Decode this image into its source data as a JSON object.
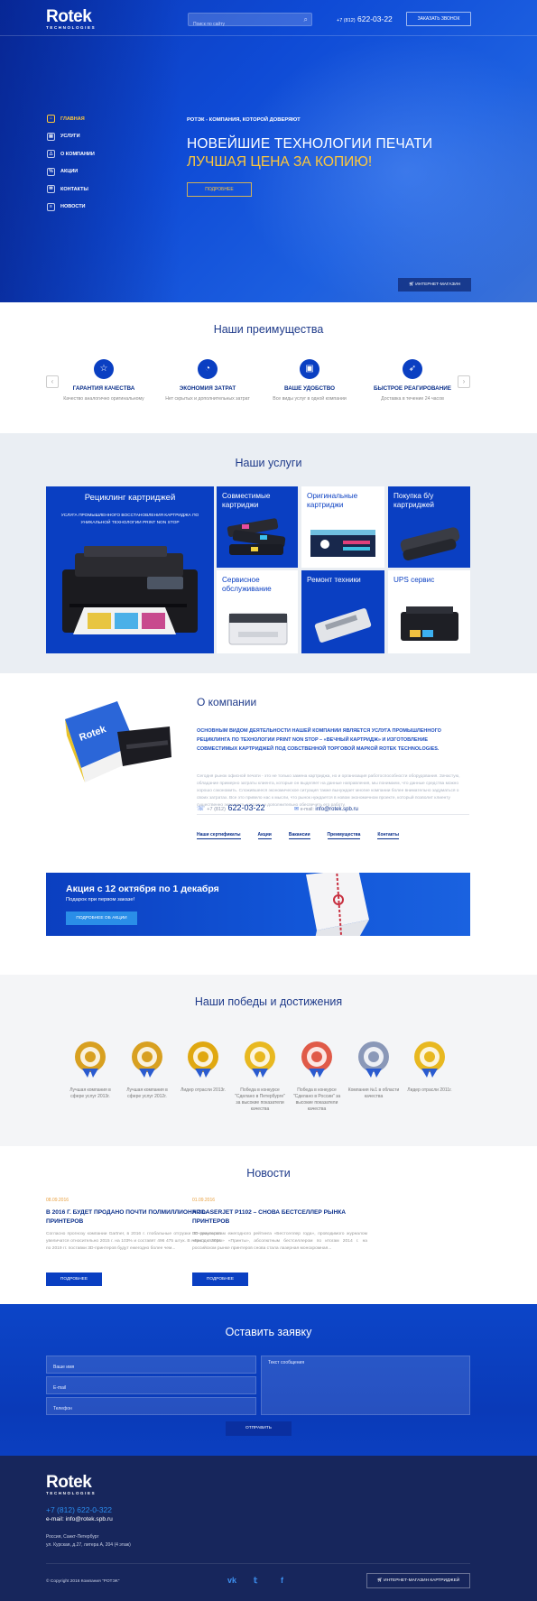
{
  "header": {
    "logo_main": "Rotek",
    "logo_sub": "TECHNOLOGIES",
    "search_placeholder": "Поиск по сайту",
    "phone_prefix": "+7 (812)",
    "phone_number": "622-03-22",
    "callback_button": "ЗАКАЗАТЬ ЗВОНОК"
  },
  "nav": {
    "items": [
      {
        "label": "ГЛАВНАЯ",
        "icon": "home-icon",
        "active": true
      },
      {
        "label": "УСЛУГИ",
        "icon": "services-icon"
      },
      {
        "label": "О КОМПАНИИ",
        "icon": "company-icon"
      },
      {
        "label": "АКЦИИ",
        "icon": "percent-icon"
      },
      {
        "label": "КОНТАКТЫ",
        "icon": "contacts-icon"
      },
      {
        "label": "НОВОСТИ",
        "icon": "news-icon"
      }
    ]
  },
  "hero": {
    "kicker": "РОТЭК - КОМПАНИЯ, КОТОРОЙ ДОВЕРЯЮТ",
    "title_line1": "НОВЕЙШИЕ ТЕХНОЛОГИИ ПЕЧАТИ",
    "title_line2": "ЛУЧШАЯ ЦЕНА ЗА КОПИЮ!",
    "more_button": "ПОДРОБНЕЕ",
    "shop_button": "ИНТЕРНЕТ-МАГАЗИН"
  },
  "advantages": {
    "title": "Наши преимущества",
    "items": [
      {
        "title": "ГАРАНТИЯ КАЧЕСТВА",
        "desc": "Качество аналогично оригинальному",
        "icon": "quality-icon"
      },
      {
        "title": "ЭКОНОМИЯ ЗАТРАТ",
        "desc": "Нет скрытых и дополнительных затрат",
        "icon": "savings-icon"
      },
      {
        "title": "ВАШЕ УДОБСТВО",
        "desc": "Все виды услуг в одной компании",
        "icon": "convenience-icon"
      },
      {
        "title": "БЫСТРОЕ РЕАГИРОВАНИЕ",
        "desc": "Доставка в течение 24 часов",
        "icon": "rocket-icon"
      }
    ]
  },
  "services": {
    "title": "Наши услуги",
    "main": {
      "title": "Рециклинг картриджей",
      "desc": "УСЛУГА ПРОМЫШЛЕННОГО ВОССТАНОВЛЕНИЯ КАРТРИДЖА ПО УНИКАЛЬНОЙ ТЕХНОЛОГИИ PRINT NON STOP"
    },
    "tiles": [
      {
        "label": "Совместимые картриджи"
      },
      {
        "label": "Оригинальные картриджи"
      },
      {
        "label": "Покупка б/у картриджей"
      },
      {
        "label": "Сервисное обслуживание"
      },
      {
        "label": "Ремонт техники"
      },
      {
        "label": "UPS сервис"
      }
    ]
  },
  "about": {
    "title": "О компании",
    "lead": "ОСНОВНЫМ ВИДОМ ДЕЯТЕЛЬНОСТИ НАШЕЙ КОМПАНИИ ЯВЛЯЕТСЯ УСЛУГА ПРОМЫШЛЕННОГО РЕЦИКЛИНГА ПО ТЕХНОЛОГИИ PRINT NON STOP – «ВЕЧНЫЙ КАРТРИДЖ» И ИЗГОТОВЛЕНИЕ СОВМЕСТИМЫХ КАРТРИДЖЕЙ ПОД СОБСТВЕННОЙ ТОРГОВОЙ МАРКОЙ ROTEK TECHNOLOGIES.",
    "text": "Сегодня рынок офисной печати - это не только замена картриджа, но и организация работоспособности оборудования. Зачастую, обладание примерно затраты клиента, которые он выделяет на данные направления, мы понимаем, что данные средства можно хорошо сэкономить. Сложившееся экономическое ситуация также вынуждает многие компании более внимательно задуматься о своих затратах. Все это привело нас к мысли, что рынок нуждается в новом экономичном проекте, который позволит клиенту существенно экономить затраты и дополнительно обеспечить его работу.",
    "phone_prefix": "+7 (812)",
    "phone": "622-03-22",
    "email_label": "e-mail:",
    "email": "info@rotek.spb.ru",
    "links": [
      "Наши сертификаты",
      "Акции",
      "Вакансии",
      "Преимущества",
      "Контакты"
    ]
  },
  "promo": {
    "title": "Акция с 12 октября по 1 декабря",
    "subtitle": "Подарок при первом заказе!",
    "button": "ПОДРОБНЕЕ ОБ АКЦИИ"
  },
  "achievements": {
    "title": "Наши победы и достижения",
    "items": [
      {
        "desc": "Лучшая компания в сфере услуг 2013г.",
        "color": "#d8a020"
      },
      {
        "desc": "Лучшая компания в сфере услуг 2012г.",
        "color": "#d8a020"
      },
      {
        "desc": "Лидер отрасли 2013г.",
        "color": "#e0a810"
      },
      {
        "desc": "Победа в конкурсе \"Сделано в Петербурге\" за высокие показатели качества",
        "color": "#e8b820"
      },
      {
        "desc": "Победа в конкурсе \"Сделано в России\" за высокие показатели качества",
        "color": "#e05a48"
      },
      {
        "desc": "Компания №1 в области качества",
        "color": "#8a98b8"
      },
      {
        "desc": "Лидер отрасли 2011г.",
        "color": "#e8b820"
      }
    ]
  },
  "news": {
    "title": "Новости",
    "items": [
      {
        "date": "08.09.2016",
        "title": "В 2016 Г. БУДЕТ ПРОДАНО ПОЧТИ ПОЛМИЛЛИОНА 3D-ПРИНТЕРОВ",
        "text": "Согласно прогнозу компании Gartner, в 2016 г. глобальные отгрузки 3D-принтеров увеличатся относительно 2015 г. на 103% и составят 496 475 штук. В период с 2016 по 2019 гг. поставки 3D-принтеров будут ежегодно более чем...",
        "button": "ПОДРОБНЕЕ"
      },
      {
        "date": "01.09.2016",
        "title": "HP LASERJET P1102 – СНОВА БЕСТСЕЛЛЕР РЫНКА ПРИНТЕРОВ",
        "text": "По результатам ежегодного рейтинга «Бестселлер года», проводимого журналом «Бестселлеры» «Принты», абсолютным бестселлером по итогам 2014 г. на российском рынке принтеров снова стала лазерная монохромная...",
        "button": "ПОДРОБНЕЕ"
      }
    ]
  },
  "form": {
    "title": "Оставить заявку",
    "name_placeholder": "Ваше имя",
    "email_placeholder": "E-mail",
    "phone_placeholder": "Телефон",
    "message_placeholder": "Текст сообщения",
    "submit": "ОТПРАВИТЬ"
  },
  "footer": {
    "logo_main": "Rotek",
    "logo_sub": "TECHNOLOGIES",
    "phone": "+7 (812) 622-0-322",
    "email": "e-mail: info@rotek.spb.ru",
    "address_line1": "Россия, Санкт-Петербург",
    "address_line2": "ул. Курская, д.27, литера А, 204 (4 этаж)",
    "copyright": "© Copyright 2016 Компания \"РОТЭК\"",
    "social": [
      "vk-icon",
      "twitter-icon",
      "facebook-icon"
    ],
    "shop_button": "ИНТЕРНЕТ-МАГАЗИН КАРТРИДЖЕЙ"
  },
  "colors": {
    "brand_blue": "#0a3fc2",
    "accent_yellow": "#ffc83a",
    "footer_bg": "#17265c"
  }
}
